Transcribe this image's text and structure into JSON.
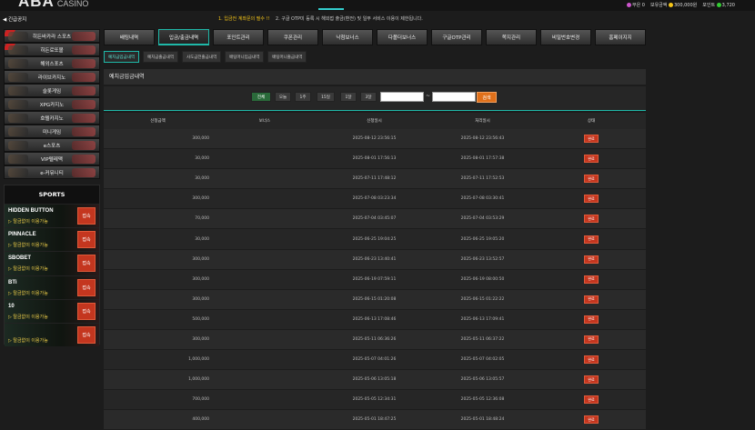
{
  "header": {
    "logo": "ABA",
    "logo_sub": "CASINO",
    "user_items": [
      "무은",
      "0",
      "보유금액",
      "300,000원",
      "포인트",
      "3,720"
    ]
  },
  "notice": {
    "label": "긴급공지",
    "text_hl": "1. 입금전 계좌문의 필수 !!",
    "text": "2. 구글 OTP미 등록 시 해외접 출금(환전) 및 일부 서비스 이용이 제한됩니다."
  },
  "sidebar": {
    "items": [
      "히든바카라 스포츠",
      "히든로또볼",
      "해외스포츠",
      "라이브카지노",
      "슬롯게임",
      "XPG카지노",
      "호텔카지노",
      "미니게임",
      "e스포츠",
      "VIP텔레맥",
      "e-커뮤니티"
    ]
  },
  "sports": {
    "title": "SPORTS",
    "rows": [
      {
        "name": "HIDDEN BUTTON",
        "sub": "▷ 탈금없이 이용가능",
        "btn": "접속"
      },
      {
        "name": "PINNACLE",
        "sub": "▷ 탈금없이 이용가능",
        "btn": "접속"
      },
      {
        "name": "SBOBET",
        "sub": "▷ 탈금없이 이용가능",
        "btn": "접속"
      },
      {
        "name": "BTi",
        "sub": "▷ 탈금없이 이용가능",
        "btn": "접속"
      },
      {
        "name": "10",
        "sub": "▷ 탈금없이 이용가능",
        "btn": "접속"
      },
      {
        "name": "",
        "sub": "▷ 탈금없이 이용가능",
        "btn": "접속"
      }
    ]
  },
  "tabs": [
    "배팅내역",
    "입금/출금내역",
    "포인트관리",
    "쿠폰관리",
    "낙첨보너스",
    "다폴더보너스",
    "구글OTP관리",
    "쪽지관리",
    "비밀번호변경",
    "홈페이지지"
  ],
  "subtabs": [
    "예치금입금내역",
    "예치금출금내역",
    "사도금전출금내역",
    "배팅머니입금내역",
    "배팅머니출금내역"
  ],
  "section_title": "예치금입금내역",
  "filters": [
    "전체",
    "오늘",
    "1주",
    "15일",
    "1달",
    "3달"
  ],
  "search_label": "검색",
  "table": {
    "headers": [
      "신청금액",
      "보너스",
      "신청일시",
      "처리일시",
      "상태"
    ],
    "rows": [
      [
        "300,000",
        "",
        "2025-08-12 23:56:15",
        "2025-08-12 23:56:43",
        "완료"
      ],
      [
        "30,000",
        "",
        "2025-08-01 17:56:13",
        "2025-08-01 17:57:38",
        "완료"
      ],
      [
        "30,000",
        "",
        "2025-07-11 17:48:12",
        "2025-07-11 17:52:53",
        "완료"
      ],
      [
        "300,000",
        "",
        "2025-07-08 03:23:34",
        "2025-07-08 03:30:41",
        "완료"
      ],
      [
        "70,000",
        "",
        "2025-07-04 03:45:07",
        "2025-07-04 03:53:29",
        "완료"
      ],
      [
        "30,000",
        "",
        "2025-06-25 19:04:25",
        "2025-06-25 19:05:20",
        "완료"
      ],
      [
        "300,000",
        "",
        "2025-06-23 13:40:41",
        "2025-06-23 13:52:57",
        "완료"
      ],
      [
        "300,000",
        "",
        "2025-06-19 07:59:11",
        "2025-06-19 08:00:50",
        "완료"
      ],
      [
        "300,000",
        "",
        "2025-06-15 01:20:08",
        "2025-06-15 01:22:22",
        "완료"
      ],
      [
        "500,000",
        "",
        "2025-06-13 17:08:46",
        "2025-06-13 17:09:41",
        "완료"
      ],
      [
        "300,000",
        "",
        "2025-05-11 06:36:26",
        "2025-05-11 06:37:22",
        "완료"
      ],
      [
        "1,000,000",
        "",
        "2025-05-07 04:01:26",
        "2025-05-07 04:02:05",
        "완료"
      ],
      [
        "1,000,000",
        "",
        "2025-05-06 13:05:18",
        "2025-05-06 13:05:57",
        "완료"
      ],
      [
        "700,000",
        "",
        "2025-05-05 12:34:31",
        "2025-05-05 12:36:08",
        "완료"
      ],
      [
        "400,000",
        "",
        "2025-05-01 18:47:25",
        "2025-05-01 18:48:24",
        "완료"
      ]
    ]
  },
  "colors": {
    "accent": "#1fb8a8",
    "status": "#c4361f",
    "search": "#e0701a"
  }
}
